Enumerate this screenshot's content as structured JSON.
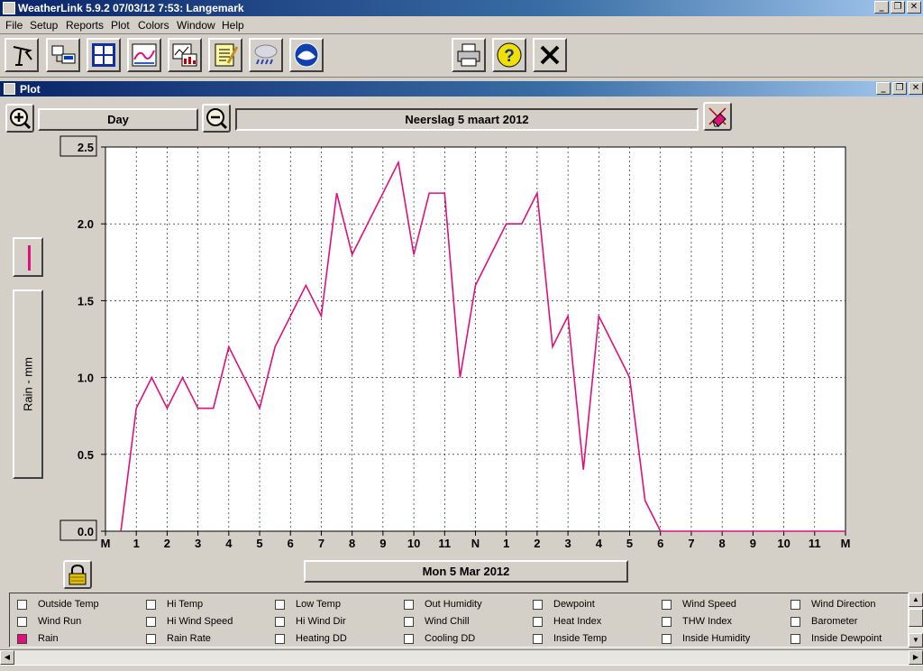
{
  "app": {
    "title": "WeatherLink 5.9.2  07/03/12   7:53: Langemark",
    "minimize": "_",
    "restore": "❐",
    "close": "✕"
  },
  "menu": [
    "File",
    "Setup",
    "Reports",
    "Plot",
    "Colors",
    "Window",
    "Help"
  ],
  "toolbar": {
    "icons": [
      "station-icon",
      "download-icon",
      "bulletin-icon",
      "summary-icon",
      "browse-icon",
      "notes-icon",
      "weather-icon",
      "noaa-icon",
      "print-icon",
      "help-icon",
      "close-icon"
    ]
  },
  "plot_window": {
    "title": "Plot",
    "zoom_in": "+",
    "zoom_out": "−",
    "span_label": "Day",
    "plot_title": "Neerslag 5 maart 2012",
    "date_label": "Mon 5 Mar 2012",
    "y_axis_label": "Rain - mm",
    "series_color": "#e0107a"
  },
  "chart_data": {
    "type": "line",
    "title": "Neerslag 5 maart 2012",
    "ylabel": "Rain - mm",
    "xlabel": "Mon 5 Mar 2012",
    "ylim": [
      0.0,
      2.5
    ],
    "y_ticks": [
      "2.5",
      "2.0",
      "1.5",
      "1.0",
      "0.5",
      "0.0"
    ],
    "x_tick_labels": [
      "M",
      "1",
      "2",
      "3",
      "4",
      "5",
      "6",
      "7",
      "8",
      "9",
      "10",
      "11",
      "N",
      "1",
      "2",
      "3",
      "4",
      "5",
      "6",
      "7",
      "8",
      "9",
      "10",
      "11",
      "M"
    ],
    "grid": true,
    "series": [
      {
        "x": [
          0.5,
          1,
          1.5,
          2,
          2.5,
          3,
          3.5,
          4,
          4.5,
          5,
          5.5,
          6,
          6.5,
          7,
          7.5,
          8,
          8.5,
          9,
          9.5,
          10,
          10.5,
          11,
          11.5,
          12,
          12.5,
          13,
          13.5,
          14,
          14.5,
          15,
          15.5,
          16,
          16.5,
          17,
          17.5,
          18,
          18.5,
          19,
          19.5,
          20,
          20.5,
          21,
          21.5,
          22,
          22.5,
          23,
          23.5,
          24
        ],
        "values": [
          0.0,
          0.8,
          1.0,
          0.8,
          1.0,
          0.8,
          0.8,
          1.2,
          1.0,
          0.8,
          1.2,
          1.4,
          1.6,
          1.4,
          2.2,
          1.8,
          2.0,
          2.2,
          2.4,
          1.8,
          2.2,
          2.2,
          1.0,
          1.6,
          1.8,
          2.0,
          2.0,
          2.2,
          1.2,
          1.4,
          0.4,
          1.4,
          1.2,
          1.0,
          0.2,
          0.0,
          0.0,
          0.0,
          0.0,
          0.0,
          0.0,
          0.0,
          0.0,
          0.0,
          0.0,
          0.0,
          0.0,
          0.0
        ]
      }
    ]
  },
  "checkboxes": [
    [
      {
        "label": "Outside Temp",
        "checked": false
      },
      {
        "label": "Hi Temp",
        "checked": false
      },
      {
        "label": "Low Temp",
        "checked": false
      },
      {
        "label": "Out Humidity",
        "checked": false
      },
      {
        "label": "Dewpoint",
        "checked": false
      },
      {
        "label": "Wind Speed",
        "checked": false
      },
      {
        "label": "Wind Direction",
        "checked": false
      }
    ],
    [
      {
        "label": "Wind Run",
        "checked": false
      },
      {
        "label": "Hi Wind Speed",
        "checked": false
      },
      {
        "label": "Hi Wind Dir",
        "checked": false
      },
      {
        "label": "Wind Chill",
        "checked": false
      },
      {
        "label": "Heat Index",
        "checked": false
      },
      {
        "label": "THW Index",
        "checked": false
      },
      {
        "label": "Barometer",
        "checked": false
      }
    ],
    [
      {
        "label": "Rain",
        "checked": true
      },
      {
        "label": "Rain Rate",
        "checked": false
      },
      {
        "label": "Heating DD",
        "checked": false
      },
      {
        "label": "Cooling DD",
        "checked": false
      },
      {
        "label": "Inside Temp",
        "checked": false
      },
      {
        "label": "Inside Humidity",
        "checked": false
      },
      {
        "label": "Inside Dewpoint",
        "checked": false
      }
    ]
  ]
}
